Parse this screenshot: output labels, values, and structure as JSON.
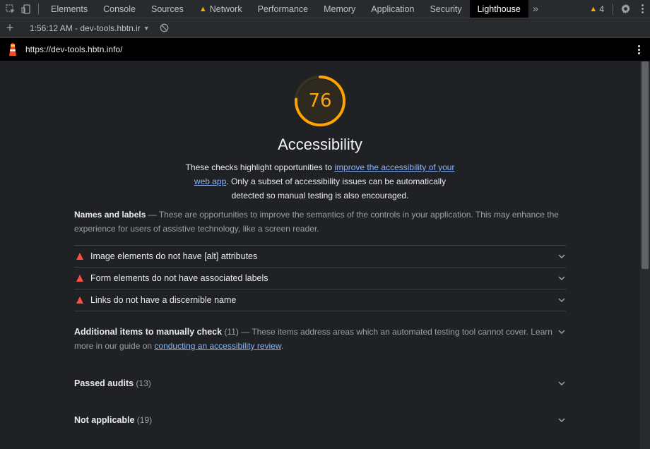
{
  "devtools": {
    "tabs": [
      {
        "label": "Elements"
      },
      {
        "label": "Console"
      },
      {
        "label": "Sources"
      },
      {
        "label": "Network",
        "warning": true
      },
      {
        "label": "Performance"
      },
      {
        "label": "Memory"
      },
      {
        "label": "Application"
      },
      {
        "label": "Security"
      },
      {
        "label": "Lighthouse",
        "active": true
      }
    ],
    "more_tabs_glyph": "»",
    "warning_count": "4",
    "icons": [
      "inspect-element-icon",
      "device-toolbar-icon",
      "more-tabs-icon",
      "warning-icon",
      "settings-gear-icon"
    ]
  },
  "lighthouse_toolbar": {
    "add_glyph": "+",
    "report_select": "1:56:12 AM - dev-tools.hbtn.ir"
  },
  "urlbar": {
    "url": "https://dev-tools.hbtn.info/"
  },
  "report": {
    "score": "76",
    "score_fraction": 0.76,
    "score_color": "#ffa400",
    "category_title": "Accessibility",
    "description": {
      "before": "These checks highlight opportunities to ",
      "link": "improve the accessibility of your web app",
      "after": ". Only a subset of accessibility issues can be automatically detected so manual testing is also encouraged."
    },
    "names_group": {
      "title": "Names and labels",
      "separator": " — ",
      "description": "These are opportunities to improve the semantics of the controls in your application. This may enhance the experience for users of assistive technology, like a screen reader."
    },
    "audits": [
      {
        "title": "Image elements do not have [alt] attributes"
      },
      {
        "title": "Form elements do not have associated labels"
      },
      {
        "title": "Links do not have a discernible name"
      }
    ],
    "manual": {
      "title": "Additional items to manually check",
      "count": "(11)",
      "separator": " — ",
      "description": "These items address areas which an automated testing tool cannot cover. Learn more in our guide on ",
      "link": "conducting an accessibility review",
      "end": "."
    },
    "passed": {
      "title": "Passed audits",
      "count": "(13)"
    },
    "not_applicable": {
      "title": "Not applicable",
      "count": "(19)"
    }
  },
  "colors": {
    "fail": "#ff4e42",
    "average": "#ffa400",
    "link": "#8ab4f8",
    "warning": "#f9ab00"
  }
}
